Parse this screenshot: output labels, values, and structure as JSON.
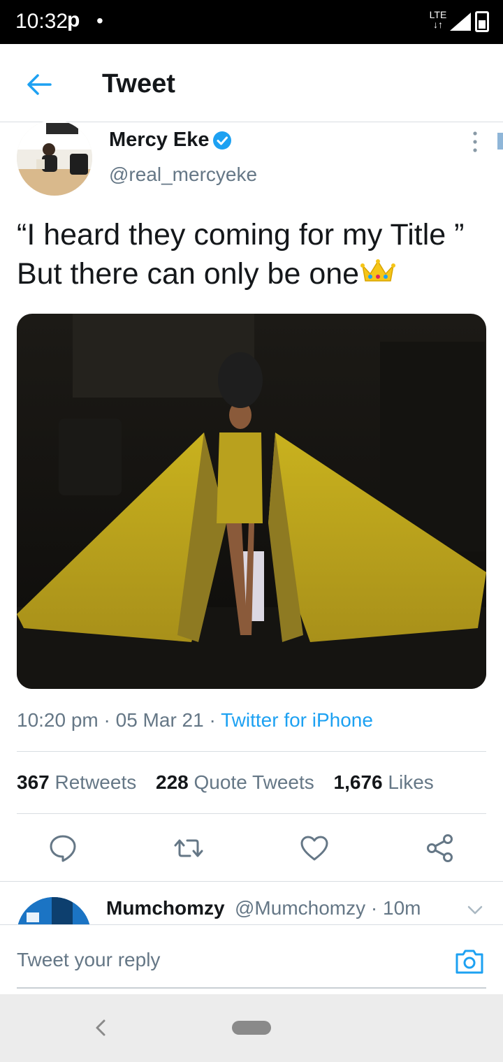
{
  "status_bar": {
    "time": "10:32",
    "p_icon": "p",
    "dot": "•",
    "network": "LTE"
  },
  "header": {
    "back_icon": "arrow-left-icon",
    "title": "Tweet"
  },
  "tweet": {
    "author_name": "Mercy Eke",
    "author_handle": "@real_mercyeke",
    "text": "“I heard they coming for my Title ” But there can only be one",
    "emoji": "crown-icon",
    "timestamp": "10:20 pm · 05 Mar 21 · ",
    "source": "Twitter for iPhone",
    "stats": {
      "retweets_count": "367",
      "retweets_label": "Retweets",
      "quotes_count": "228",
      "quotes_label": "Quote Tweets",
      "likes_count": "1,676",
      "likes_label": "Likes"
    }
  },
  "actions": [
    "reply-icon",
    "retweet-icon",
    "like-icon",
    "share-icon"
  ],
  "reply": {
    "name": "Mumchomzy",
    "meta": "@Mumchomzy · 10m"
  },
  "compose": {
    "placeholder": "Tweet your reply"
  },
  "colors": {
    "accent": "#1da1f2",
    "muted": "#657786",
    "text": "#14171a"
  }
}
